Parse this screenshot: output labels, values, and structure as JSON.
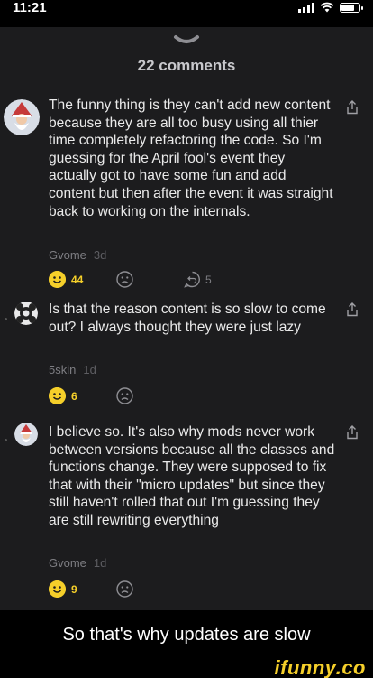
{
  "status_bar": {
    "time": "11:21"
  },
  "sheet": {
    "title": "22 comments"
  },
  "comments": [
    {
      "text": "The funny thing is they can't add new content because they are all too busy using all thier time completely refactoring the code. So I'm guessing for the April fool's event they actually got to have some fun and add content but then after the event it was straight back to working on the internals.",
      "author": "Gvome",
      "age": "3d",
      "smiles": "44",
      "replies": "5"
    },
    {
      "text": "Is that the reason content is so slow to come out? I always thought they were just lazy",
      "author": "5skin",
      "age": "1d",
      "smiles": "6"
    },
    {
      "text": "I believe so. It's also why mods never work between versions because all the classes and functions change. They were supposed to fix that with their \"micro updates\" but since they still haven't rolled that out I'm guessing they are still rewriting everything",
      "author": "Gvome",
      "age": "1d",
      "smiles": "9"
    }
  ],
  "caption": "So that's why updates are slow",
  "watermark": "ifunny.co",
  "colors": {
    "background": "#000000",
    "sheet": "#1c1c1e",
    "smile_accent": "#f5cf2a",
    "meta_text": "#7d7d82"
  },
  "icons": [
    "wifi-icon",
    "signal-icon",
    "battery-icon",
    "chevron-down-icon",
    "share-icon",
    "smile-icon",
    "frown-icon",
    "reply-icon"
  ]
}
